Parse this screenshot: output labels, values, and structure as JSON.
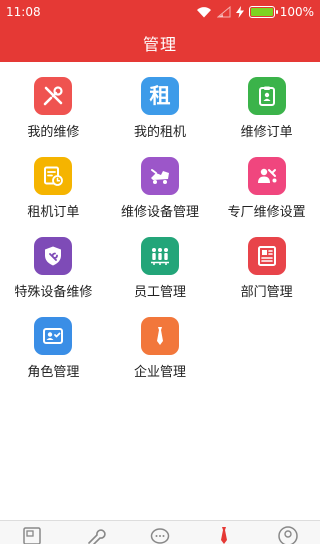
{
  "status_bar": {
    "time": "11:08",
    "battery": "100%"
  },
  "header": {
    "title": "管理"
  },
  "colors": {
    "brand": "#e53935",
    "tile_red": "#ef5350",
    "tile_blue": "#3d9be9",
    "tile_green": "#3bb34a",
    "tile_yellow": "#f5b400",
    "tile_purple": "#9c56c9",
    "tile_pink": "#f0467e",
    "tile_violet": "#7e4bb7",
    "tile_teal": "#23a579",
    "tile_crimson": "#e8444a",
    "tile_sky": "#3a8ee6",
    "tile_orange": "#f2773b"
  },
  "menu": [
    {
      "label": "我的维修",
      "icon": "tools-icon"
    },
    {
      "label": "我的租机",
      "icon": "rent-icon",
      "glyph": "租"
    },
    {
      "label": "维修订单",
      "icon": "clipboard-icon"
    },
    {
      "label": "租机订单",
      "icon": "order-clock-icon"
    },
    {
      "label": "维修设备管理",
      "icon": "equipment-icon"
    },
    {
      "label": "专厂维修设置",
      "icon": "mechanic-icon"
    },
    {
      "label": "特殊设备维修",
      "icon": "shield-icon"
    },
    {
      "label": "员工管理",
      "icon": "staff-icon"
    },
    {
      "label": "部门管理",
      "icon": "department-icon"
    },
    {
      "label": "角色管理",
      "icon": "role-card-icon"
    },
    {
      "label": "企业管理",
      "icon": "enterprise-icon"
    }
  ],
  "bottom_nav": [
    {
      "icon": "news-icon"
    },
    {
      "icon": "wrench-icon"
    },
    {
      "icon": "chat-icon"
    },
    {
      "icon": "tie-icon",
      "active": true
    },
    {
      "icon": "user-icon"
    }
  ]
}
